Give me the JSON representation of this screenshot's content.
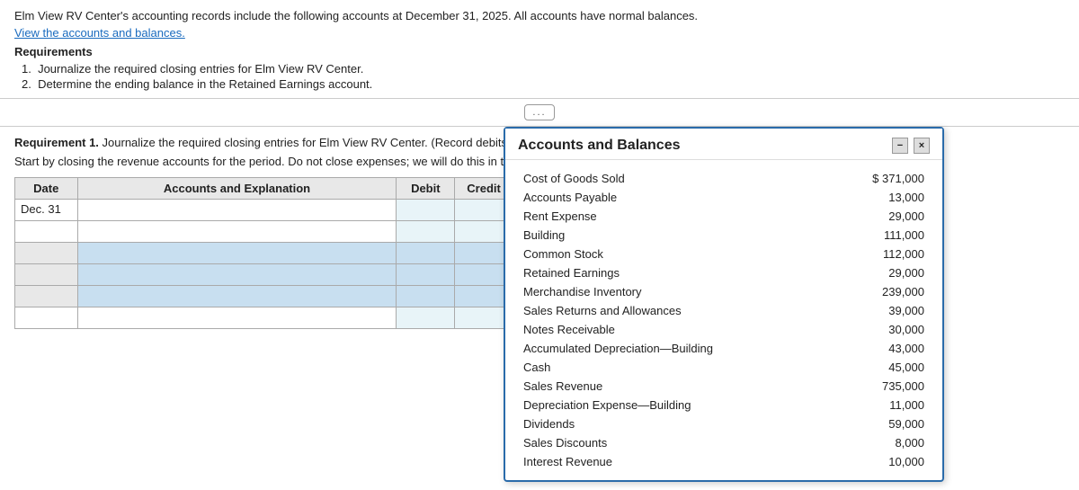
{
  "top": {
    "intro": "Elm View RV Center's accounting records include the following accounts at December 31, 2025. All accounts have normal balances.",
    "link": "View the accounts and balances.",
    "requirements_label": "Requirements",
    "req1": "Journalize the required closing entries for Elm View RV Center.",
    "req2": "Determine the ending balance in the Retained Earnings account."
  },
  "divider": {
    "dots": "..."
  },
  "requirement1": {
    "label": "Requirement 1.",
    "text": " Journalize the required closing entries for Elm View RV Center. (Record debits first, then credits. Select the explanation on the last line of the journal entry table.)",
    "instruction": "Start by closing the revenue accounts for the period. Do not close expenses; we will do this in the next step."
  },
  "journal_table": {
    "headers": {
      "date": "Date",
      "accounts": "Accounts and Explanation",
      "debit": "Debit",
      "credit": "Credit"
    },
    "date_label": "Dec. 31",
    "rows": [
      {
        "date": "Dec. 31",
        "account": "",
        "debit": "",
        "credit": "",
        "highlighted": false
      },
      {
        "date": "",
        "account": "",
        "debit": "",
        "credit": "",
        "highlighted": false
      },
      {
        "date": "",
        "account": "",
        "debit": "",
        "credit": "",
        "highlighted": true
      },
      {
        "date": "",
        "account": "",
        "debit": "",
        "credit": "",
        "highlighted": true
      },
      {
        "date": "",
        "account": "",
        "debit": "",
        "credit": "",
        "highlighted": true
      },
      {
        "date": "",
        "account": "",
        "debit": "",
        "credit": "",
        "highlighted": false
      }
    ]
  },
  "popup": {
    "title": "Accounts and Balances",
    "minimize_label": "−",
    "close_label": "×",
    "accounts": [
      {
        "name": "Cost of Goods Sold",
        "value": "$ 371,000",
        "bold": false
      },
      {
        "name": "Accounts Payable",
        "value": "13,000",
        "bold": false
      },
      {
        "name": "Rent Expense",
        "value": "29,000",
        "bold": false
      },
      {
        "name": "Building",
        "value": "111,000",
        "bold": false
      },
      {
        "name": "Common Stock",
        "value": "112,000",
        "bold": false
      },
      {
        "name": "Retained Earnings",
        "value": "29,000",
        "bold": false
      },
      {
        "name": "Merchandise Inventory",
        "value": "239,000",
        "bold": false
      },
      {
        "name": "Sales Returns and Allowances",
        "value": "39,000",
        "bold": false
      },
      {
        "name": "Notes Receivable",
        "value": "30,000",
        "bold": false
      },
      {
        "name": "Accumulated Depreciation—Building",
        "value": "43,000",
        "bold": false
      },
      {
        "name": "Cash",
        "value": "45,000",
        "bold": false
      },
      {
        "name": "Sales Revenue",
        "value": "735,000",
        "bold": false
      },
      {
        "name": "Depreciation Expense—Building",
        "value": "11,000",
        "bold": false
      },
      {
        "name": "Dividends",
        "value": "59,000",
        "bold": false
      },
      {
        "name": "Sales Discounts",
        "value": "8,000",
        "bold": false
      },
      {
        "name": "Interest Revenue",
        "value": "10,000",
        "bold": false
      }
    ]
  }
}
